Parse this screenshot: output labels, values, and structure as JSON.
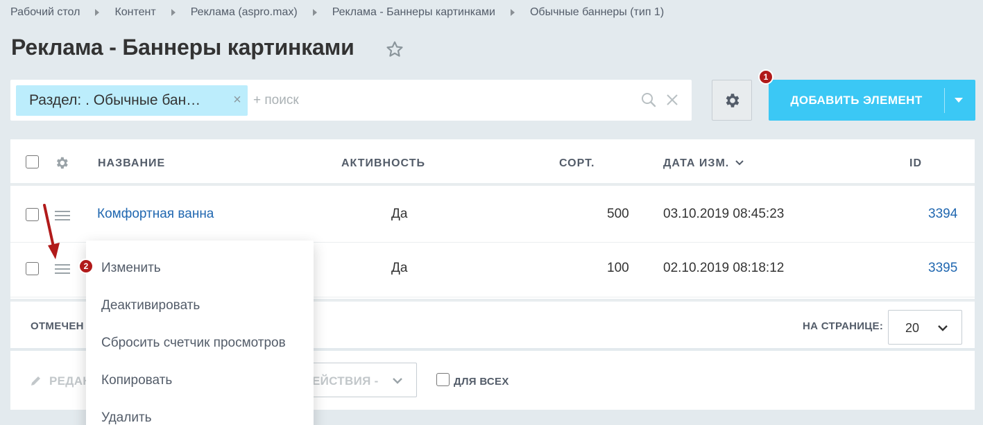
{
  "breadcrumb": [
    "Рабочий стол",
    "Контент",
    "Реклама (aspro.max)",
    "Реклама - Баннеры картинками",
    "Обычные баннеры (тип 1)"
  ],
  "page_title": "Реклама - Баннеры картинками",
  "filter": {
    "chip_label": "Раздел: . Обычные бан…",
    "search_placeholder": "+ поиск"
  },
  "toolbar": {
    "add_button_label": "ДОБАВИТЬ ЭЛЕМЕНТ",
    "badge_1": "1",
    "badge_2": "2"
  },
  "table": {
    "headers": {
      "name": "НАЗВАНИЕ",
      "activity": "АКТИВНОСТЬ",
      "sort": "СОРТ.",
      "date": "ДАТА ИЗМ.",
      "id": "ID"
    },
    "rows": [
      {
        "name": "Комфортная ванна",
        "activity": "Да",
        "sort": "500",
        "date": "03.10.2019 08:45:23",
        "id": "3394"
      },
      {
        "name": "",
        "activity": "Да",
        "sort": "100",
        "date": "02.10.2019 08:18:12",
        "id": "3395"
      }
    ]
  },
  "footer": {
    "selected_label": "ОТМЕЧЕН",
    "per_page_label": "НА СТРАНИЦЕ:",
    "per_page_value": "20"
  },
  "actions": {
    "edit_label": "РЕДАК",
    "actions_select_label": "ЕЙСТВИЯ -",
    "for_all_label": "ДЛЯ ВСЕХ"
  },
  "context_menu": [
    "Изменить",
    "Деактивировать",
    "Сбросить счетчик просмотров",
    "Копировать",
    "Удалить"
  ],
  "colors": {
    "accent": "#3bc8f5",
    "chip_bg": "#bcedfc",
    "link": "#2067b0",
    "badge": "#b11a1a",
    "arrow": "#b11a1a"
  }
}
